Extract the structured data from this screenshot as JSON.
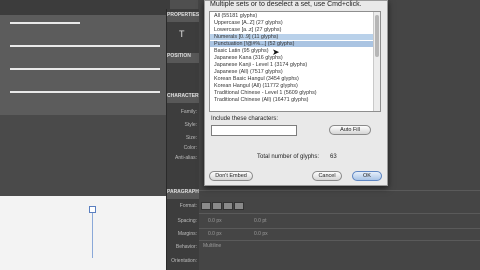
{
  "panel": {
    "header": "PROPERTIES",
    "type_icon": "T",
    "position_section": "POSITION",
    "character_section": "CHARACTER",
    "character_labels": [
      "Family:",
      "Style:",
      "Size:",
      "Color:",
      "Anti-alias:"
    ],
    "paragraph_section": "PARAGRAPH",
    "paragraph_labels": [
      "Format:",
      "Spacing:",
      "Margins:",
      "Behavior:",
      "Orientation:"
    ],
    "spacing_values": [
      "0.0 px",
      "0.0 pt"
    ],
    "margin_values": [
      "0.0 px",
      "0.0 px"
    ],
    "behavior_value": "Multiline"
  },
  "dialog": {
    "title": "Multiple sets or to deselect a set, use Cmd+click.",
    "list_items": [
      {
        "label": "All (55181 glyphs)",
        "selected": false
      },
      {
        "label": "Uppercase [A..Z] (27 glyphs)",
        "selected": false
      },
      {
        "label": "Lowercase [a..z] (27 glyphs)",
        "selected": false
      },
      {
        "label": "Numerals [0..9] (11 glyphs)",
        "selected": true
      },
      {
        "label": "Punctuation [!@#%...] (52 glyphs)",
        "selected": true
      },
      {
        "label": "Basic Latin (95 glyphs)",
        "selected": false
      },
      {
        "label": "Japanese Kana (316 glyphs)",
        "selected": false
      },
      {
        "label": "Japanese Kanji - Level 1 (3174 glyphs)",
        "selected": false
      },
      {
        "label": "Japanese (All) (7517 glyphs)",
        "selected": false
      },
      {
        "label": "Korean Basic Hangul (3454 glyphs)",
        "selected": false
      },
      {
        "label": "Korean Hangul (All) (11772 glyphs)",
        "selected": false
      },
      {
        "label": "Traditional Chinese - Level 1 (5609 glyphs)",
        "selected": false
      },
      {
        "label": "Traditional Chinese (All) (16471 glyphs)",
        "selected": false
      }
    ],
    "include_label": "Include these characters:",
    "include_value": "",
    "auto_fill_label": "Auto Fill",
    "total_label": "Total number of glyphs:",
    "total_value": "63",
    "dont_embed_label": "Don't Embed",
    "cancel_label": "Cancel",
    "ok_label": "OK"
  }
}
